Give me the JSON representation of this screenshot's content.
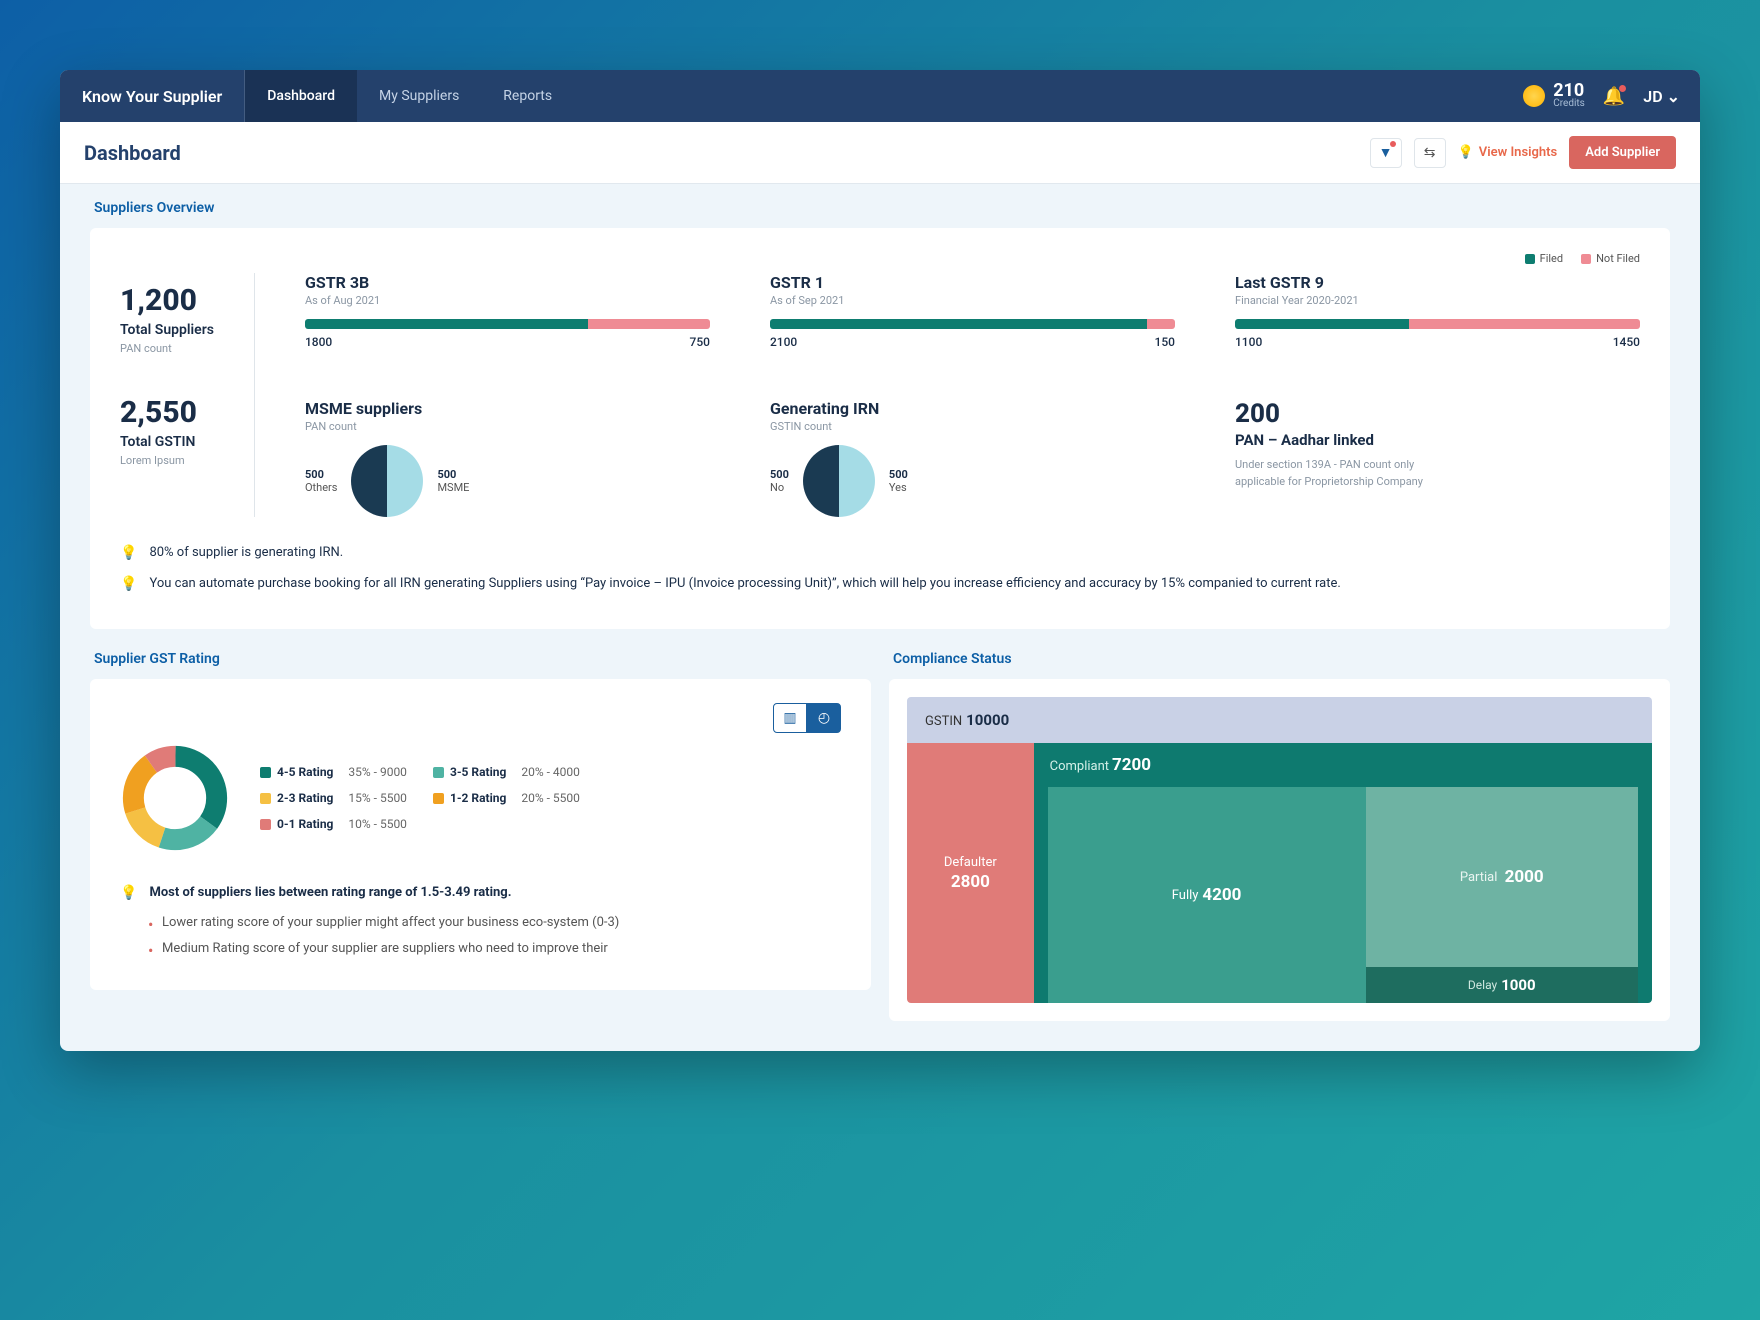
{
  "header": {
    "brand": "Know Your Supplier",
    "tabs": [
      "Dashboard",
      "My Suppliers",
      "Reports"
    ],
    "activeTab": 0,
    "credits": {
      "amount": "210",
      "label": "Credits"
    },
    "user": "JD ⌄"
  },
  "subhead": {
    "title": "Dashboard",
    "insights": "View  Insights",
    "addSupplier": "Add Supplier"
  },
  "overview": {
    "title": "Suppliers Overview",
    "legend": {
      "filed": "Filed",
      "notFiled": "Not Filed"
    },
    "totalSuppliers": {
      "value": "1,200",
      "label": "Total Suppliers",
      "sub": "PAN count"
    },
    "totalGstin": {
      "value": "2,550",
      "label": "Total GSTIN",
      "sub": "Lorem Ipsum"
    },
    "gstr3b": {
      "title": "GSTR 3B",
      "sub": "As of Aug 2021",
      "filed": "1800",
      "notFiled": "750",
      "filedPct": 70
    },
    "gstr1": {
      "title": "GSTR 1",
      "sub": "As of Sep 2021",
      "filed": "2100",
      "notFiled": "150",
      "filedPct": 93
    },
    "gstr9": {
      "title": "Last GSTR 9",
      "sub": "Financial Year 2020-2021",
      "filed": "1100",
      "notFiled": "1450",
      "filedPct": 43
    },
    "msme": {
      "title": "MSME suppliers",
      "sub": "PAN count",
      "left": {
        "val": "500",
        "lbl": "Others"
      },
      "right": {
        "val": "500",
        "lbl": "MSME"
      }
    },
    "irn": {
      "title": "Generating IRN",
      "sub": "GSTIN count",
      "left": {
        "val": "500",
        "lbl": "No"
      },
      "right": {
        "val": "500",
        "lbl": "Yes"
      }
    },
    "linked": {
      "value": "200",
      "title": "PAN – Aadhar linked",
      "sub": "Under section 139A - PAN count only applicable for Proprietorship Company"
    },
    "insight1": "80% of supplier is generating IRN.",
    "insight2": "You can automate purchase booking for all IRN generating Suppliers using “Pay invoice – IPU (Invoice processing Unit)”, which will help you increase efficiency and accuracy by 15% companied to current rate."
  },
  "rating": {
    "title": "Supplier GST Rating",
    "legend": [
      {
        "label": "4-5 Rating",
        "value": "35% - 9000",
        "color": "#0e7d70"
      },
      {
        "label": "3-5 Rating",
        "value": "20% - 4000",
        "color": "#4fb3a3"
      },
      {
        "label": "2-3 Rating",
        "value": "15% - 5500",
        "color": "#f5c043"
      },
      {
        "label": "1-2 Rating",
        "value": "20% - 5500",
        "color": "#f0a020"
      },
      {
        "label": "0-1 Rating",
        "value": "10% - 5500",
        "color": "#e07b78"
      }
    ],
    "insight": "Most of suppliers lies between rating range of 1.5-3.49 rating.",
    "bullets": [
      "Lower rating score of your supplier might affect your business eco-system (0-3)",
      "Medium Rating score of your supplier are suppliers who need to improve their"
    ]
  },
  "compliance": {
    "title": "Compliance Status",
    "gstin": {
      "label": "GSTIN",
      "value": "10000"
    },
    "defaulter": {
      "label": "Defaulter",
      "value": "2800"
    },
    "compliant": {
      "label": "Compliant",
      "value": "7200"
    },
    "fully": {
      "label": "Fully",
      "value": "4200"
    },
    "partial": {
      "label": "Partial",
      "value": "2000"
    },
    "delay": {
      "label": "Delay",
      "value": "1000"
    }
  },
  "colors": {
    "filed": "#0e7d70",
    "notFiled": "#ef8b94",
    "pieLight": "#a5dce6",
    "pieDark": "#1a3a52"
  },
  "chart_data": [
    {
      "type": "bar",
      "title": "GSTR 3B",
      "note": "As of Aug 2021",
      "categories": [
        "Filed",
        "Not Filed"
      ],
      "values": [
        1800,
        750
      ]
    },
    {
      "type": "bar",
      "title": "GSTR 1",
      "note": "As of Sep 2021",
      "categories": [
        "Filed",
        "Not Filed"
      ],
      "values": [
        2100,
        150
      ]
    },
    {
      "type": "bar",
      "title": "Last GSTR 9",
      "note": "Financial Year 2020-2021",
      "categories": [
        "Filed",
        "Not Filed"
      ],
      "values": [
        1100,
        1450
      ]
    },
    {
      "type": "pie",
      "title": "MSME suppliers",
      "categories": [
        "Others",
        "MSME"
      ],
      "values": [
        500,
        500
      ]
    },
    {
      "type": "pie",
      "title": "Generating IRN",
      "categories": [
        "No",
        "Yes"
      ],
      "values": [
        500,
        500
      ]
    },
    {
      "type": "pie",
      "title": "Supplier GST Rating",
      "series": [
        {
          "name": "4-5 Rating",
          "pct": 35,
          "count": 9000
        },
        {
          "name": "3-5 Rating",
          "pct": 20,
          "count": 4000
        },
        {
          "name": "2-3 Rating",
          "pct": 15,
          "count": 5500
        },
        {
          "name": "1-2 Rating",
          "pct": 20,
          "count": 5500
        },
        {
          "name": "0-1 Rating",
          "pct": 10,
          "count": 5500
        }
      ]
    },
    {
      "type": "treemap",
      "title": "Compliance Status",
      "total_label": "GSTIN",
      "total": 10000,
      "nodes": [
        {
          "name": "Defaulter",
          "value": 2800
        },
        {
          "name": "Compliant",
          "value": 7200,
          "children": [
            {
              "name": "Fully",
              "value": 4200
            },
            {
              "name": "Partial",
              "value": 2000
            },
            {
              "name": "Delay",
              "value": 1000
            }
          ]
        }
      ]
    }
  ]
}
